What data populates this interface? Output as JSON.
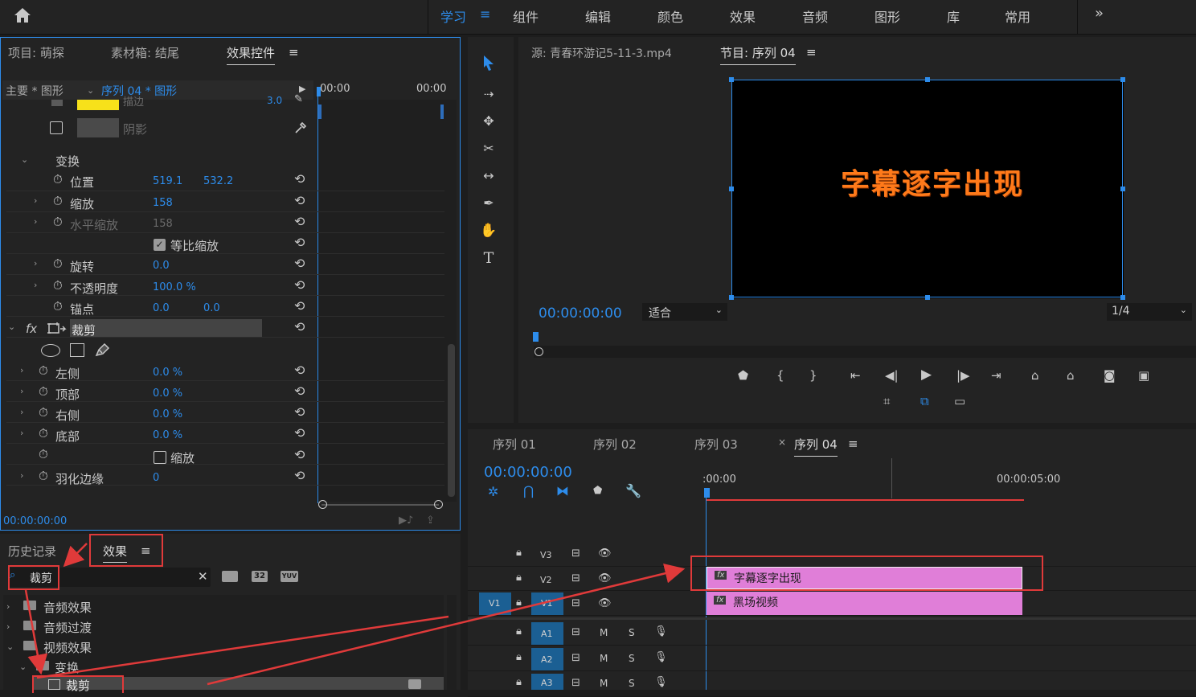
{
  "workspaces": [
    "学习",
    "组件",
    "编辑",
    "颜色",
    "效果",
    "音频",
    "图形",
    "库",
    "常用"
  ],
  "workspace_menu_glyph": "≡",
  "overflow_glyph": "»",
  "left_tabs": {
    "project": "项目: 萌探",
    "bin": "素材箱: 结尾",
    "effect_controls": "效果控件"
  },
  "ec_header": {
    "master": "主要 * 图形",
    "seq": "序列 04 * 图形",
    "t0": "00:00",
    "t1": "00:00"
  },
  "ec": {
    "stroke_label": "描边",
    "stroke_val": "3.0",
    "shadow": "阴影",
    "transform": "变换",
    "position": "位置",
    "pos_x": "519.1",
    "pos_y": "532.2",
    "scale": "缩放",
    "scale_val": "158",
    "hscale": "水平缩放",
    "hscale_val": "158",
    "uniform": "等比缩放",
    "rotation": "旋转",
    "rotation_val": "0.0",
    "opacity": "不透明度",
    "opacity_val": "100.0 %",
    "anchor": "锚点",
    "anchor_x": "0.0",
    "anchor_y": "0.0",
    "fx": "fx",
    "crop": "裁剪",
    "left": "左侧",
    "left_val": "0.0 %",
    "top": "顶部",
    "top_val": "0.0 %",
    "right": "右侧",
    "right_val": "0.0 %",
    "bottom": "底部",
    "bottom_val": "0.0 %",
    "zoom": "缩放",
    "feather": "羽化边缘",
    "feather_val": "0",
    "timecode": "00:00:00:00"
  },
  "source_tab": "源: 青春环游记5-11-3.mp4",
  "program_tab": "节目: 序列 04",
  "program": {
    "title_text": "字幕逐字出现",
    "timecode": "00:00:00:00",
    "fit": "适合",
    "ratio": "1/4"
  },
  "effects_panel": {
    "history": "历史记录",
    "effects": "效果",
    "search": "裁剪",
    "b32": "32",
    "yuv": "YUV",
    "audio_effects": "音频效果",
    "audio_trans": "音频过渡",
    "video_effects": "视频效果",
    "transform": "变换",
    "crop": "裁剪"
  },
  "timeline": {
    "tabs": [
      "序列 01",
      "序列 02",
      "序列 03",
      "序列 04"
    ],
    "timecode": "00:00:00:00",
    "ruler": [
      ":00:00",
      "00:00:05:00"
    ],
    "tracks": [
      "V3",
      "V2",
      "V1",
      "A1",
      "A2",
      "A3"
    ],
    "v1_src": "V1",
    "m": "M",
    "s": "S",
    "clip_v2": "字幕逐字出现",
    "clip_v1": "黑场视频",
    "fx": "fx"
  },
  "colors": {
    "accent": "#2d8ceb",
    "clip": "#e07ed8",
    "title": "#ff7a1a",
    "annotation": "#e03a3a"
  }
}
